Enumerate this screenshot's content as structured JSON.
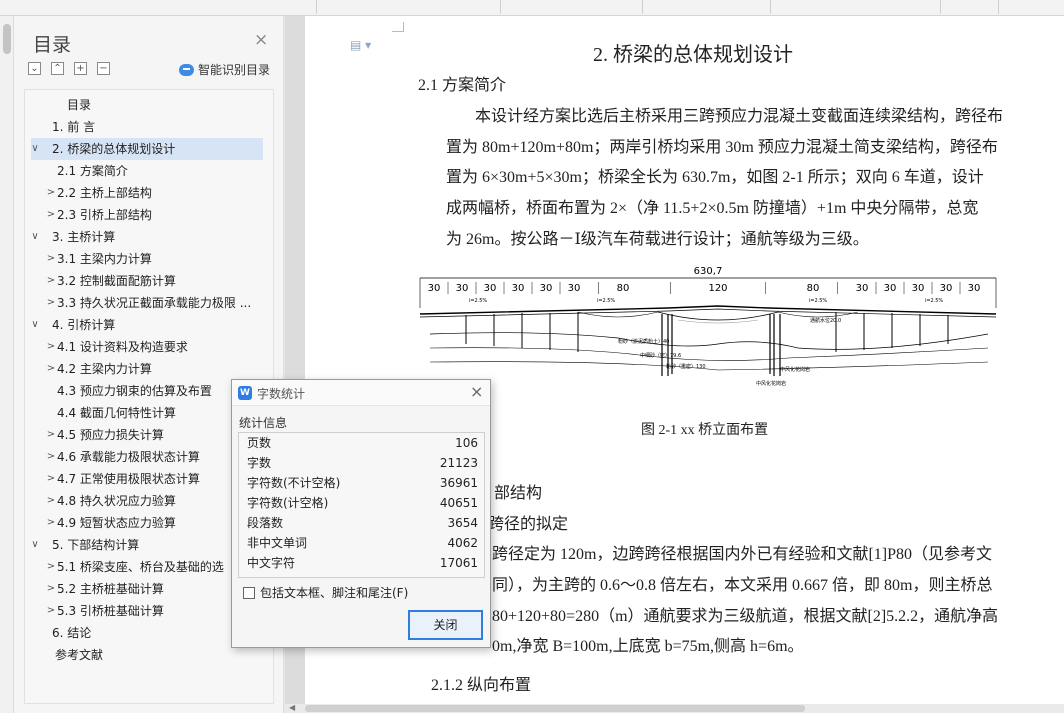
{
  "toolbar": {
    "items": [
      "",
      "",
      "",
      "",
      "",
      "",
      "",
      "",
      "",
      "",
      "",
      ""
    ]
  },
  "nav": {
    "title": "目录",
    "smart_toc_label": "智能识别目录",
    "toc": [
      {
        "label": "目录",
        "arrow": ""
      },
      {
        "label": "1.  前 言",
        "arrow": ""
      },
      {
        "label": "2.  桥梁的总体规划设计",
        "arrow": "∨"
      },
      {
        "label": "2.1 方案简介",
        "arrow": ""
      },
      {
        "label": "2.2 主桥上部结构",
        "arrow": ">"
      },
      {
        "label": "2.3 引桥上部结构",
        "arrow": ">"
      },
      {
        "label": "3.  主桥计算",
        "arrow": "∨"
      },
      {
        "label": "3.1 主梁内力计算",
        "arrow": ">"
      },
      {
        "label": "3.2 控制截面配筋计算",
        "arrow": ">"
      },
      {
        "label": "3.3 持久状况正截面承载能力极限 ...",
        "arrow": ">"
      },
      {
        "label": "4.  引桥计算",
        "arrow": "∨"
      },
      {
        "label": "4.1 设计资料及构造要求",
        "arrow": ">"
      },
      {
        "label": "4.2 主梁内力计算",
        "arrow": ">"
      },
      {
        "label": "4.3 预应力钢束的估算及布置",
        "arrow": ""
      },
      {
        "label": "4.4 截面几何特性计算",
        "arrow": ""
      },
      {
        "label": "4.5 预应力损失计算",
        "arrow": ">"
      },
      {
        "label": "4.6 承载能力极限状态计算",
        "arrow": ">"
      },
      {
        "label": "4.7 正常使用极限状态计算",
        "arrow": ">"
      },
      {
        "label": "4.8 持久状况应力验算",
        "arrow": ">"
      },
      {
        "label": "4.9 短暂状态应力验算",
        "arrow": ">"
      },
      {
        "label": "5.  下部结构计算",
        "arrow": "∨"
      },
      {
        "label": "5.1 桥梁支座、桥台及基础的选",
        "arrow": ">"
      },
      {
        "label": "5.2 主桥桩基础计算",
        "arrow": ">"
      },
      {
        "label": "5.3 引桥桩基础计算",
        "arrow": ">"
      },
      {
        "label": "6.  结论",
        "arrow": ""
      },
      {
        "label": "参考文献",
        "arrow": ""
      }
    ]
  },
  "document": {
    "chapter_title": "2.    桥梁的总体规划设计",
    "section_title": "2.1  方案简介",
    "paragraph_lines": [
      "本设计经方案比选后主桥采用三跨预应力混凝土变截面连续梁结构，跨径布",
      "置为 80m+120m+80m；两岸引桥均采用 30m 预应力混凝土简支梁结构，跨径布",
      "置为 6×30m+5×30m；桥梁全长为 630.7m，如图 2-1 所示；双向 6 车道，设计",
      "成两幅桥，桥面布置为 2×（净 11.5+2×0.5m 防撞墙）+1m 中央分隔带，总宽",
      "为 26m。按公路－Ⅰ级汽车荷载进行设计；通航等级为三级。"
    ],
    "figure": {
      "total_length": "630,7",
      "spans": [
        "30",
        "30",
        "30",
        "30",
        "30",
        "30",
        "80",
        "120",
        "80",
        "30",
        "30",
        "30",
        "30",
        "30"
      ],
      "slope_labels": [
        "i=2.5%",
        "i=2.5%",
        "i=2.5%",
        "i=2.5%"
      ],
      "water_label": "通航水位20.0",
      "stratum_labels": [
        "粉砂（淤泥质粉土）40",
        "中细砂（密）79.6",
        "粉砂（重密）130",
        "中风化花岗岩",
        "中风化花岗岩"
      ]
    },
    "figure_caption": "图 2-1   xx 桥立面布置",
    "section_22": "部结构",
    "section_211": "跨径的拟定",
    "paragraph2_lines": [
      "跨径定为 120m，边跨跨径根据国内外已有经验和文献[1]P80（见参考文",
      "同），为主跨的 0.6～0.8 倍左右，本文采用 0.667 倍，即 80m，则主桥总",
      " 80+120+80=280（m）通航要求为三级航道，根据文献[2]5.2.2，通航净高",
      "0m,净宽 B=100m,上底宽 b=75m,侧高 h=6m。"
    ],
    "section_212": "2.1.2 纵向布置"
  },
  "dialog": {
    "title": "字数统计",
    "section": "统计信息",
    "stats": [
      {
        "label": "页数",
        "value": "106"
      },
      {
        "label": "字数",
        "value": "21123"
      },
      {
        "label": "字符数(不计空格)",
        "value": "36961"
      },
      {
        "label": "字符数(计空格)",
        "value": "40651"
      },
      {
        "label": "段落数",
        "value": "3654"
      },
      {
        "label": "非中文单词",
        "value": "4062"
      },
      {
        "label": "中文字符",
        "value": "17061"
      }
    ],
    "checkbox_label": "包括文本框、脚注和尾注(F)",
    "checkbox_checked": false,
    "close_button": "关闭"
  },
  "colors": {
    "accent": "#2f7de1",
    "selection": "#d6e4f5"
  }
}
